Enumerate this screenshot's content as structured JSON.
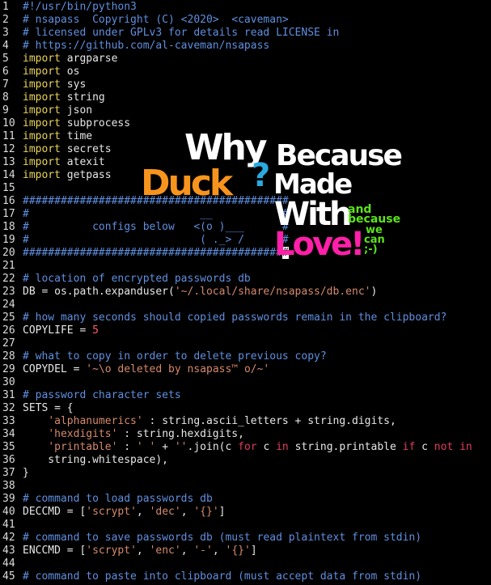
{
  "editor": {
    "lines": [
      {
        "n": "1",
        "t": [
          [
            "c-com",
            "#!/usr/bin/python3"
          ]
        ]
      },
      {
        "n": "2",
        "t": [
          [
            "c-com",
            "# nsapass  Copyright (C) <2020>  <caveman>"
          ]
        ]
      },
      {
        "n": "3",
        "t": [
          [
            "c-com",
            "# licensed under GPLv3 for details read LICENSE in"
          ]
        ]
      },
      {
        "n": "4",
        "t": [
          [
            "c-com",
            "# https://github.com/al-caveman/nsapass"
          ]
        ]
      },
      {
        "n": "5",
        "t": [
          [
            "c-kw",
            "import"
          ],
          [
            "c-txt",
            " argparse"
          ]
        ]
      },
      {
        "n": "6",
        "t": [
          [
            "c-kw",
            "import"
          ],
          [
            "c-txt",
            " os"
          ]
        ]
      },
      {
        "n": "7",
        "t": [
          [
            "c-kw",
            "import"
          ],
          [
            "c-txt",
            " sys"
          ]
        ]
      },
      {
        "n": "8",
        "t": [
          [
            "c-kw",
            "import"
          ],
          [
            "c-txt",
            " string"
          ]
        ]
      },
      {
        "n": "9",
        "t": [
          [
            "c-kw",
            "import"
          ],
          [
            "c-txt",
            " json"
          ]
        ]
      },
      {
        "n": "10",
        "t": [
          [
            "c-kw",
            "import"
          ],
          [
            "c-txt",
            " subprocess"
          ]
        ]
      },
      {
        "n": "11",
        "t": [
          [
            "c-kw",
            "import"
          ],
          [
            "c-txt",
            " time"
          ]
        ]
      },
      {
        "n": "12",
        "t": [
          [
            "c-kw",
            "import"
          ],
          [
            "c-txt",
            " secrets"
          ]
        ]
      },
      {
        "n": "13",
        "t": [
          [
            "c-kw",
            "import"
          ],
          [
            "c-txt",
            " atexit"
          ]
        ]
      },
      {
        "n": "14",
        "t": [
          [
            "c-kw",
            "import"
          ],
          [
            "c-txt",
            " getpass"
          ]
        ]
      },
      {
        "n": "15",
        "t": []
      },
      {
        "n": "16",
        "t": [
          [
            "c-com",
            "##########################################"
          ]
        ]
      },
      {
        "n": "17",
        "t": [
          [
            "c-com",
            "#                           __           #"
          ]
        ]
      },
      {
        "n": "18",
        "t": [
          [
            "c-com",
            "#          configs below   <(o )___      #"
          ]
        ]
      },
      {
        "n": "19",
        "t": [
          [
            "c-com",
            "#                           ( ._> /      #"
          ]
        ]
      },
      {
        "n": "20",
        "t": [
          [
            "c-com",
            "#########################################"
          ],
          [
            "cursor",
            "#"
          ]
        ]
      },
      {
        "n": "21",
        "t": []
      },
      {
        "n": "22",
        "t": [
          [
            "c-com",
            "# location of encrypted passwords db"
          ]
        ]
      },
      {
        "n": "23",
        "t": [
          [
            "c-txt",
            "DB = os.path.expanduser("
          ],
          [
            "c-str",
            "'~/.local/share/nsapass/db.enc'"
          ],
          [
            "c-txt",
            ")"
          ]
        ]
      },
      {
        "n": "24",
        "t": []
      },
      {
        "n": "25",
        "t": [
          [
            "c-com",
            "# how many seconds should copied passwords remain in the clipboard?"
          ]
        ]
      },
      {
        "n": "26",
        "t": [
          [
            "c-txt",
            "COPYLIFE = "
          ],
          [
            "c-num",
            "5"
          ]
        ]
      },
      {
        "n": "27",
        "t": []
      },
      {
        "n": "28",
        "t": [
          [
            "c-com",
            "# what to copy in order to delete previous copy?"
          ]
        ]
      },
      {
        "n": "29",
        "t": [
          [
            "c-txt",
            "COPYDEL = "
          ],
          [
            "c-str",
            "'~\\o deleted by nsapass™ o/~'"
          ]
        ]
      },
      {
        "n": "30",
        "t": []
      },
      {
        "n": "31",
        "t": [
          [
            "c-com",
            "# password character sets"
          ]
        ]
      },
      {
        "n": "32",
        "t": [
          [
            "c-txt",
            "SETS = {"
          ]
        ]
      },
      {
        "n": "33",
        "t": [
          [
            "c-txt",
            "    "
          ],
          [
            "c-str",
            "'alphanumerics'"
          ],
          [
            "c-txt",
            " : string.ascii_letters + string.digits,"
          ]
        ]
      },
      {
        "n": "34",
        "t": [
          [
            "c-txt",
            "    "
          ],
          [
            "c-str",
            "'hexdigits'"
          ],
          [
            "c-txt",
            " : string.hexdigits,"
          ]
        ]
      },
      {
        "n": "35",
        "t": [
          [
            "c-txt",
            "    "
          ],
          [
            "c-str",
            "'printable'"
          ],
          [
            "c-txt",
            " : "
          ],
          [
            "c-str",
            "' '"
          ],
          [
            "c-txt",
            " + "
          ],
          [
            "c-str",
            "''"
          ],
          [
            "c-txt",
            ".join(c "
          ],
          [
            "c-red",
            "for"
          ],
          [
            "c-txt",
            " c "
          ],
          [
            "c-red",
            "in"
          ],
          [
            "c-txt",
            " string.printable "
          ],
          [
            "c-red",
            "if"
          ],
          [
            "c-txt",
            " c "
          ],
          [
            "c-red",
            "not in"
          ]
        ]
      },
      {
        "n": "36",
        "t": [
          [
            "c-txt",
            "    string.whitespace),"
          ]
        ]
      },
      {
        "n": "37",
        "t": [
          [
            "c-txt",
            "}"
          ]
        ]
      },
      {
        "n": "38",
        "t": []
      },
      {
        "n": "39",
        "t": [
          [
            "c-com",
            "# command to load passwords db"
          ]
        ]
      },
      {
        "n": "40",
        "t": [
          [
            "c-txt",
            "DECCMD = ["
          ],
          [
            "c-str",
            "'scrypt'"
          ],
          [
            "c-txt",
            ", "
          ],
          [
            "c-str",
            "'dec'"
          ],
          [
            "c-txt",
            ", "
          ],
          [
            "c-str",
            "'{}'"
          ],
          [
            "c-txt",
            "]"
          ]
        ]
      },
      {
        "n": "41",
        "t": []
      },
      {
        "n": "42",
        "t": [
          [
            "c-com",
            "# command to save passwords db (must read plaintext from stdin)"
          ]
        ]
      },
      {
        "n": "43",
        "t": [
          [
            "c-txt",
            "ENCCMD = ["
          ],
          [
            "c-str",
            "'scrypt'"
          ],
          [
            "c-txt",
            ", "
          ],
          [
            "c-str",
            "'enc'"
          ],
          [
            "c-txt",
            ", "
          ],
          [
            "c-str",
            "'-'"
          ],
          [
            "c-txt",
            ", "
          ],
          [
            "c-str",
            "'{}'"
          ],
          [
            "c-txt",
            "]"
          ]
        ]
      },
      {
        "n": "44",
        "t": []
      },
      {
        "n": "45",
        "t": [
          [
            "c-com",
            "# command to paste into clipboard (must accept data from stdin)"
          ]
        ]
      }
    ]
  },
  "logo": {
    "why": "Why",
    "because": "Because",
    "duck": "Duck",
    "question": "?",
    "made": "Made",
    "with": "With",
    "and_because": "and because",
    "love": "Love!",
    "we": "we",
    "can": "can",
    "smiley": ";-)"
  },
  "colors": {
    "background": "#000000",
    "comment": "#5f8fdf",
    "keyword": "#e9d35a",
    "string": "#d58a6a",
    "number": "#ff5f5f",
    "duck": "#f7941d",
    "question": "#2aa9e0",
    "love": "#ff1fa8",
    "green": "#5be31b"
  }
}
